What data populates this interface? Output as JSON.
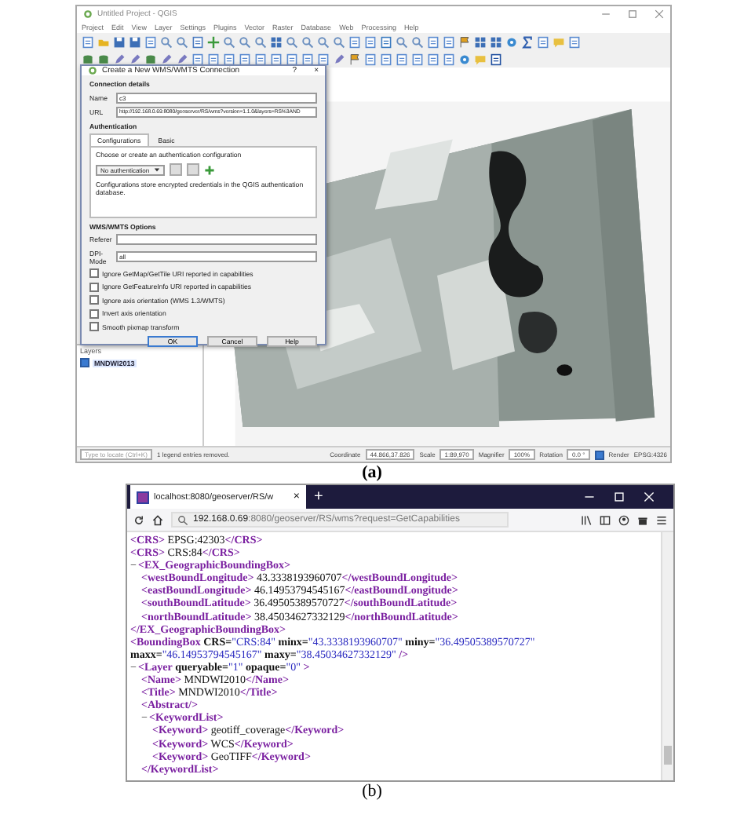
{
  "figure_a": {
    "caption": "(a)",
    "window": {
      "title": "Untitled Project - QGIS",
      "menu": [
        "Project",
        "Edit",
        "View",
        "Layer",
        "Settings",
        "Plugins",
        "Vector",
        "Raster",
        "Database",
        "Web",
        "Processing",
        "Help"
      ]
    },
    "dialog": {
      "title": "Create a New WMS/WMTS Connection",
      "title_buttons": [
        "?",
        "×"
      ],
      "section": "Connection details",
      "name_label": "Name",
      "name_value": "c3",
      "url_label": "URL",
      "url_value": "http://192.168.0.69:8080/geoserver/RS/wms?version=1.1.0&layers=RS%3AND",
      "auth_title": "Authentication",
      "tabs": [
        {
          "label": "Configurations",
          "selected": true
        },
        {
          "label": "Basic",
          "selected": false
        }
      ],
      "auth_hint": "Choose or create an authentication configuration",
      "auth_select": "No authentication",
      "auth_note": "Configurations store encrypted credentials in the QGIS authentication database.",
      "options_title": "WMS/WMTS Options",
      "referer_label": "Referer",
      "dpi_label": "DPI-Mode",
      "dpi_value": "all",
      "checkboxes": [
        {
          "label": "Ignore GetMap/GetTile URI reported in capabilities",
          "checked": false
        },
        {
          "label": "Ignore GetFeatureInfo URI reported in capabilities",
          "checked": false
        },
        {
          "label": "Ignore axis orientation (WMS 1.3/WMTS)",
          "checked": false
        },
        {
          "label": "Invert axis orientation",
          "checked": false
        },
        {
          "label": "Smooth pixmap transform",
          "checked": false
        }
      ],
      "buttons": [
        {
          "label": "OK",
          "default": true
        },
        {
          "label": "Cancel",
          "default": false
        },
        {
          "label": "Help",
          "default": false
        }
      ]
    },
    "layers_panel": {
      "title": "Layers",
      "layers": [
        {
          "name": "MNDWI2013",
          "checked": true
        }
      ]
    },
    "status_bar": {
      "locate_placeholder": "Type to locate (Ctrl+K)",
      "message": "1 legend entries removed.",
      "coordinate_label": "Coordinate",
      "coordinate": "44.866,37.826",
      "scale_label": "Scale",
      "scale": "1:89,970",
      "magnifier_label": "Magnifier",
      "magnifier": "100%",
      "rotation_label": "Rotation",
      "rotation": "0.0 °",
      "render_label": "Render",
      "render_checked": true,
      "crs": "EPSG:4326"
    }
  },
  "figure_b": {
    "caption": "(b)",
    "tab": {
      "title": "localhost:8080/geoserver/RS/w",
      "close": "×"
    },
    "new_tab": "+",
    "address": {
      "host": "192.168.0.69",
      "path": ":8080/geoserver/RS/wms?request=GetCapabilities"
    },
    "xml": [
      {
        "tokens": [
          {
            "kind": "tag",
            "text": "<CRS>"
          },
          {
            "kind": "text",
            "text": "EPSG:42303"
          },
          {
            "kind": "tag",
            "text": "</CRS>"
          }
        ]
      },
      {
        "tokens": [
          {
            "kind": "tag",
            "text": "<CRS>"
          },
          {
            "kind": "text",
            "text": "CRS:84"
          },
          {
            "kind": "tag",
            "text": "</CRS>"
          }
        ]
      },
      {
        "toggle": "−",
        "tokens": [
          {
            "kind": "tag",
            "text": "<EX_GeographicBoundingBox>"
          }
        ],
        "children": [
          {
            "tokens": [
              {
                "kind": "tag",
                "text": "<westBoundLongitude>"
              },
              {
                "kind": "text",
                "text": "43.3338193960707"
              },
              {
                "kind": "tag",
                "text": "</westBoundLongitude>"
              }
            ]
          },
          {
            "tokens": [
              {
                "kind": "tag",
                "text": "<eastBoundLongitude>"
              },
              {
                "kind": "text",
                "text": "46.14953794545167"
              },
              {
                "kind": "tag",
                "text": "</eastBoundLongitude>"
              }
            ]
          },
          {
            "tokens": [
              {
                "kind": "tag",
                "text": "<southBoundLatitude>"
              },
              {
                "kind": "text",
                "text": "36.49505389570727"
              },
              {
                "kind": "tag",
                "text": "</southBoundLatitude>"
              }
            ]
          },
          {
            "tokens": [
              {
                "kind": "tag",
                "text": "<northBoundLatitude>"
              },
              {
                "kind": "text",
                "text": "38.450346273321​29"
              },
              {
                "kind": "tag",
                "text": "</northBoundLatitude>"
              }
            ]
          }
        ]
      },
      {
        "tokens": [
          {
            "kind": "tag",
            "text": "</EX_GeographicBoundingBox>"
          }
        ]
      },
      {
        "tokens": [
          {
            "kind": "tag",
            "text": "<BoundingBox"
          },
          {
            "kind": "attr",
            "text": "CRS="
          },
          {
            "kind": "value",
            "text": "\"CRS:84\""
          },
          {
            "kind": "attr",
            "text": "minx="
          },
          {
            "kind": "value",
            "text": "\"43.3338193960707\""
          },
          {
            "kind": "attr",
            "text": "miny="
          },
          {
            "kind": "value",
            "text": "\"36.49505389570727\""
          }
        ]
      },
      {
        "tokens": [
          {
            "kind": "attr",
            "text": "maxx="
          },
          {
            "kind": "value",
            "text": "\"46.14953794545167\""
          },
          {
            "kind": "attr",
            "text": "maxy="
          },
          {
            "kind": "value",
            "text": "\"38.45034627332129\""
          },
          {
            "kind": "tag",
            "text": "/>"
          }
        ]
      },
      {
        "toggle": "−",
        "tokens": [
          {
            "kind": "tag",
            "text": "<Layer"
          },
          {
            "kind": "attr",
            "text": "queryable="
          },
          {
            "kind": "value",
            "text": "\"1\""
          },
          {
            "kind": "attr",
            "text": "opaque="
          },
          {
            "kind": "value",
            "text": "\"0\""
          },
          {
            "kind": "tag",
            "text": ">"
          }
        ],
        "children": [
          {
            "tokens": [
              {
                "kind": "tag",
                "text": "<Name>"
              },
              {
                "kind": "text",
                "text": "MNDWI2010"
              },
              {
                "kind": "tag",
                "text": "</Name>"
              }
            ]
          },
          {
            "tokens": [
              {
                "kind": "tag",
                "text": "<Title>"
              },
              {
                "kind": "text",
                "text": "MNDWI2010"
              },
              {
                "kind": "tag",
                "text": "</Title>"
              }
            ]
          },
          {
            "tokens": [
              {
                "kind": "tag",
                "text": "<Abstract/>"
              }
            ]
          },
          {
            "toggle": "−",
            "tokens": [
              {
                "kind": "tag",
                "text": "<KeywordList>"
              }
            ],
            "children": [
              {
                "tokens": [
                  {
                    "kind": "tag",
                    "text": "<Keyword>"
                  },
                  {
                    "kind": "text",
                    "text": "geotiff_coverage"
                  },
                  {
                    "kind": "tag",
                    "text": "</Keyword>"
                  }
                ]
              },
              {
                "tokens": [
                  {
                    "kind": "tag",
                    "text": "<Keyword>"
                  },
                  {
                    "kind": "text",
                    "text": "WCS"
                  },
                  {
                    "kind": "tag",
                    "text": "</Keyword>"
                  }
                ]
              },
              {
                "tokens": [
                  {
                    "kind": "tag",
                    "text": "<Keyword>"
                  },
                  {
                    "kind": "text",
                    "text": "GeoTIFF"
                  },
                  {
                    "kind": "tag",
                    "text": "</Keyword>"
                  }
                ]
              }
            ]
          },
          {
            "tokens": [
              {
                "kind": "tag",
                "text": "</KeywordList>"
              }
            ]
          }
        ]
      }
    ]
  }
}
